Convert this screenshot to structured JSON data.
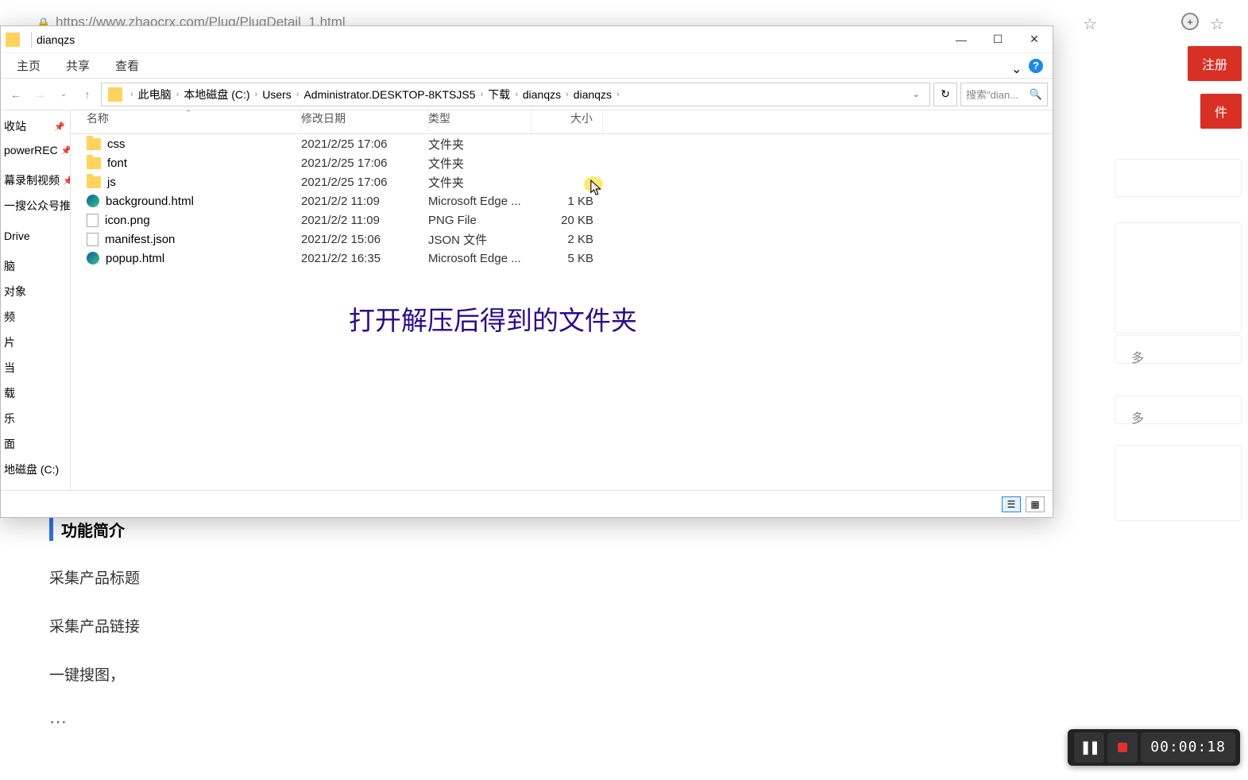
{
  "browser": {
    "url": "https://www.zhaocrx.com/Plug/PlugDetail_1.html",
    "register": "注册",
    "side_btn": "件",
    "more": "多"
  },
  "explorer": {
    "title": "dianqzs",
    "tabs": {
      "home": "主页",
      "share": "共享",
      "view": "查看"
    },
    "breadcrumb": [
      "此电脑",
      "本地磁盘 (C:)",
      "Users",
      "Administrator.DESKTOP-8KTSJS5",
      "下载",
      "dianqzs",
      "dianqzs"
    ],
    "search_placeholder": "搜索\"dian...",
    "columns": {
      "name": "名称",
      "date": "修改日期",
      "type": "类型",
      "size": "大小"
    },
    "files": [
      {
        "icon": "folder",
        "name": "css",
        "date": "2021/2/25 17:06",
        "type": "文件夹",
        "size": ""
      },
      {
        "icon": "folder",
        "name": "font",
        "date": "2021/2/25 17:06",
        "type": "文件夹",
        "size": ""
      },
      {
        "icon": "folder",
        "name": "js",
        "date": "2021/2/25 17:06",
        "type": "文件夹",
        "size": ""
      },
      {
        "icon": "edge",
        "name": "background.html",
        "date": "2021/2/2 11:09",
        "type": "Microsoft Edge ...",
        "size": "1 KB"
      },
      {
        "icon": "png",
        "name": "icon.png",
        "date": "2021/2/2 11:09",
        "type": "PNG File",
        "size": "20 KB"
      },
      {
        "icon": "json",
        "name": "manifest.json",
        "date": "2021/2/2 15:06",
        "type": "JSON 文件",
        "size": "2 KB"
      },
      {
        "icon": "edge",
        "name": "popup.html",
        "date": "2021/2/2 16:35",
        "type": "Microsoft Edge ...",
        "size": "5 KB"
      }
    ],
    "nav_items": [
      "收站",
      "powerREC",
      "",
      "幕录制视频",
      "一搜公众号推",
      "",
      "Drive",
      "",
      "脑",
      "对象",
      "频",
      "片",
      "当",
      "载",
      "乐",
      "面",
      "地磁盘 (C:)"
    ],
    "nav_pinned": [
      "当",
      "收站"
    ]
  },
  "annotation": "打开解压后得到的文件夹",
  "webpage": {
    "section_title": "功能简介",
    "lines": [
      "采集产品标题",
      "采集产品链接",
      "一键搜图，"
    ],
    "dots": "⋯"
  },
  "recorder": {
    "time": "00:00:18"
  }
}
